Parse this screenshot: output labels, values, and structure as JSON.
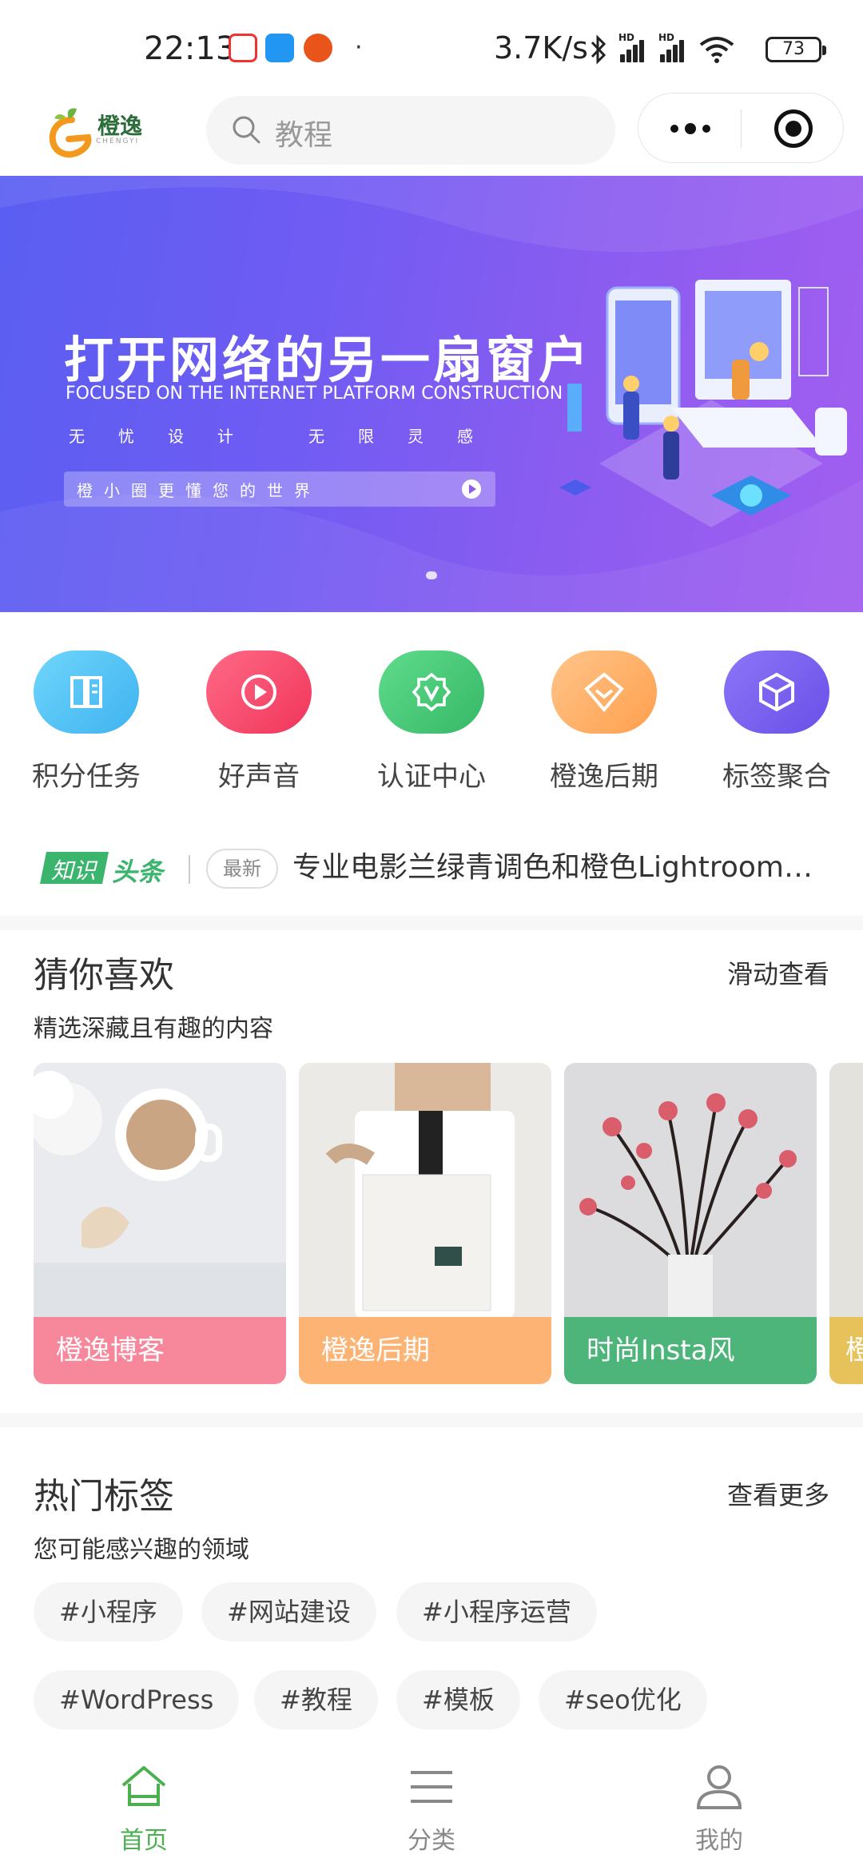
{
  "status_bar": {
    "time": "22:13",
    "dot": "·",
    "net_speed": "3.7K/s",
    "signal_label": "HD",
    "battery": "73"
  },
  "header": {
    "logo_text": "橙逸",
    "logo_sub": "CHENGYI",
    "search_placeholder": "教程"
  },
  "banner": {
    "title": "打开网络的另一扇窗户",
    "subtitle": "FOCUSED ON THE INTERNET PLATFORM CONSTRUCTION",
    "tag_left": "无忧设计",
    "tag_right": "无限灵感",
    "bar_text": "橙小圈更懂您的世界"
  },
  "quick_nav": [
    {
      "label": "积分任务",
      "color": "#5bc8f5",
      "icon": "book-icon"
    },
    {
      "label": "好声音",
      "color": "#f4466a",
      "icon": "play-icon"
    },
    {
      "label": "认证中心",
      "color": "#48c774",
      "icon": "verified-icon"
    },
    {
      "label": "橙逸后期",
      "color": "#ffb36b",
      "icon": "diamond-icon"
    },
    {
      "label": "标签聚合",
      "color": "#7b61f5",
      "icon": "cube-icon"
    }
  ],
  "ticker": {
    "badge_a": "知识",
    "badge_b": "头条",
    "new_label": "最新",
    "headline": "专业电影兰绿青调色和橙色Lightroom…"
  },
  "guess": {
    "title": "猜你喜欢",
    "more": "滑动查看",
    "subtitle": "精选深藏且有趣的内容",
    "cards": [
      {
        "label": "橙逸博客",
        "color": "#f7889c"
      },
      {
        "label": "橙逸后期",
        "color": "#fdb374"
      },
      {
        "label": "时尚Insta风",
        "color": "#4db57a"
      },
      {
        "label": "橙",
        "color": "#e7c15a"
      }
    ]
  },
  "hot_tags": {
    "title": "热门标签",
    "more": "查看更多",
    "subtitle": "您可能感兴趣的领域",
    "tags": [
      "#小程序",
      "#网站建设",
      "#小程序运营",
      "#WordPress",
      "#教程",
      "#模板",
      "#seo优化"
    ]
  },
  "tabbar": [
    {
      "label": "首页",
      "icon": "home-icon",
      "active": true
    },
    {
      "label": "分类",
      "icon": "menu-icon",
      "active": false
    },
    {
      "label": "我的",
      "icon": "user-icon",
      "active": false
    }
  ],
  "colors": {
    "accent": "#4caf50",
    "banner_start": "#5a5ef2",
    "banner_end": "#a25ef0"
  }
}
